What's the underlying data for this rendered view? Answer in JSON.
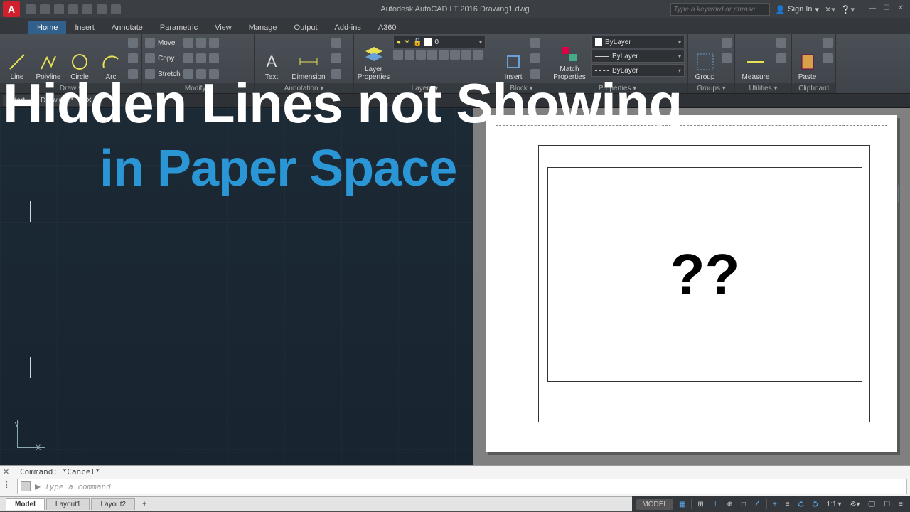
{
  "app": {
    "logo_letter": "A",
    "title": "Autodesk AutoCAD LT 2016  Drawing1.dwg",
    "search_placeholder": "Type a keyword or phrase",
    "signin": "Sign In"
  },
  "ribbon_tabs": [
    "Home",
    "Insert",
    "Annotate",
    "Parametric",
    "View",
    "Manage",
    "Output",
    "Add-ins",
    "A360"
  ],
  "ribbon": {
    "draw": {
      "label": "Draw ▾",
      "line": "Line",
      "polyline": "Polyline",
      "circle": "Circle",
      "arc": "Arc"
    },
    "modify": {
      "label": "Modify ▾",
      "move": "Move",
      "copy": "Copy",
      "stretch": "Stretch"
    },
    "annotation": {
      "label": "Annotation ▾",
      "text": "Text",
      "dimension": "Dimension"
    },
    "layers": {
      "label": "Layers ▾",
      "properties": "Layer\nProperties",
      "current": "0"
    },
    "block": {
      "label": "Block ▾",
      "insert": "Insert"
    },
    "properties": {
      "label": "Properties ▾",
      "match": "Match\nProperties",
      "color": "ByLayer",
      "linetype": "ByLayer",
      "lineweight": "ByLayer"
    },
    "groups": {
      "label": "Groups ▾",
      "group": "Group"
    },
    "utilities": {
      "label": "Utilities ▾",
      "measure": "Measure"
    },
    "clipboard": {
      "label": "Clipboard",
      "paste": "Paste"
    }
  },
  "file_tabs": {
    "start": "Start",
    "drawing": "Drawing1*"
  },
  "overlay": {
    "line1": "Hidden Lines not Showing",
    "line2": "in Paper Space"
  },
  "paper": {
    "question": "??"
  },
  "ucs": {
    "x": "X",
    "y": "Y"
  },
  "command": {
    "history": "Command: *Cancel*",
    "placeholder": "Type a command",
    "prompt_icon": ">_"
  },
  "layout_tabs": [
    "Model",
    "Layout1",
    "Layout2"
  ],
  "status": {
    "model": "MODEL",
    "scale": "1:1"
  }
}
